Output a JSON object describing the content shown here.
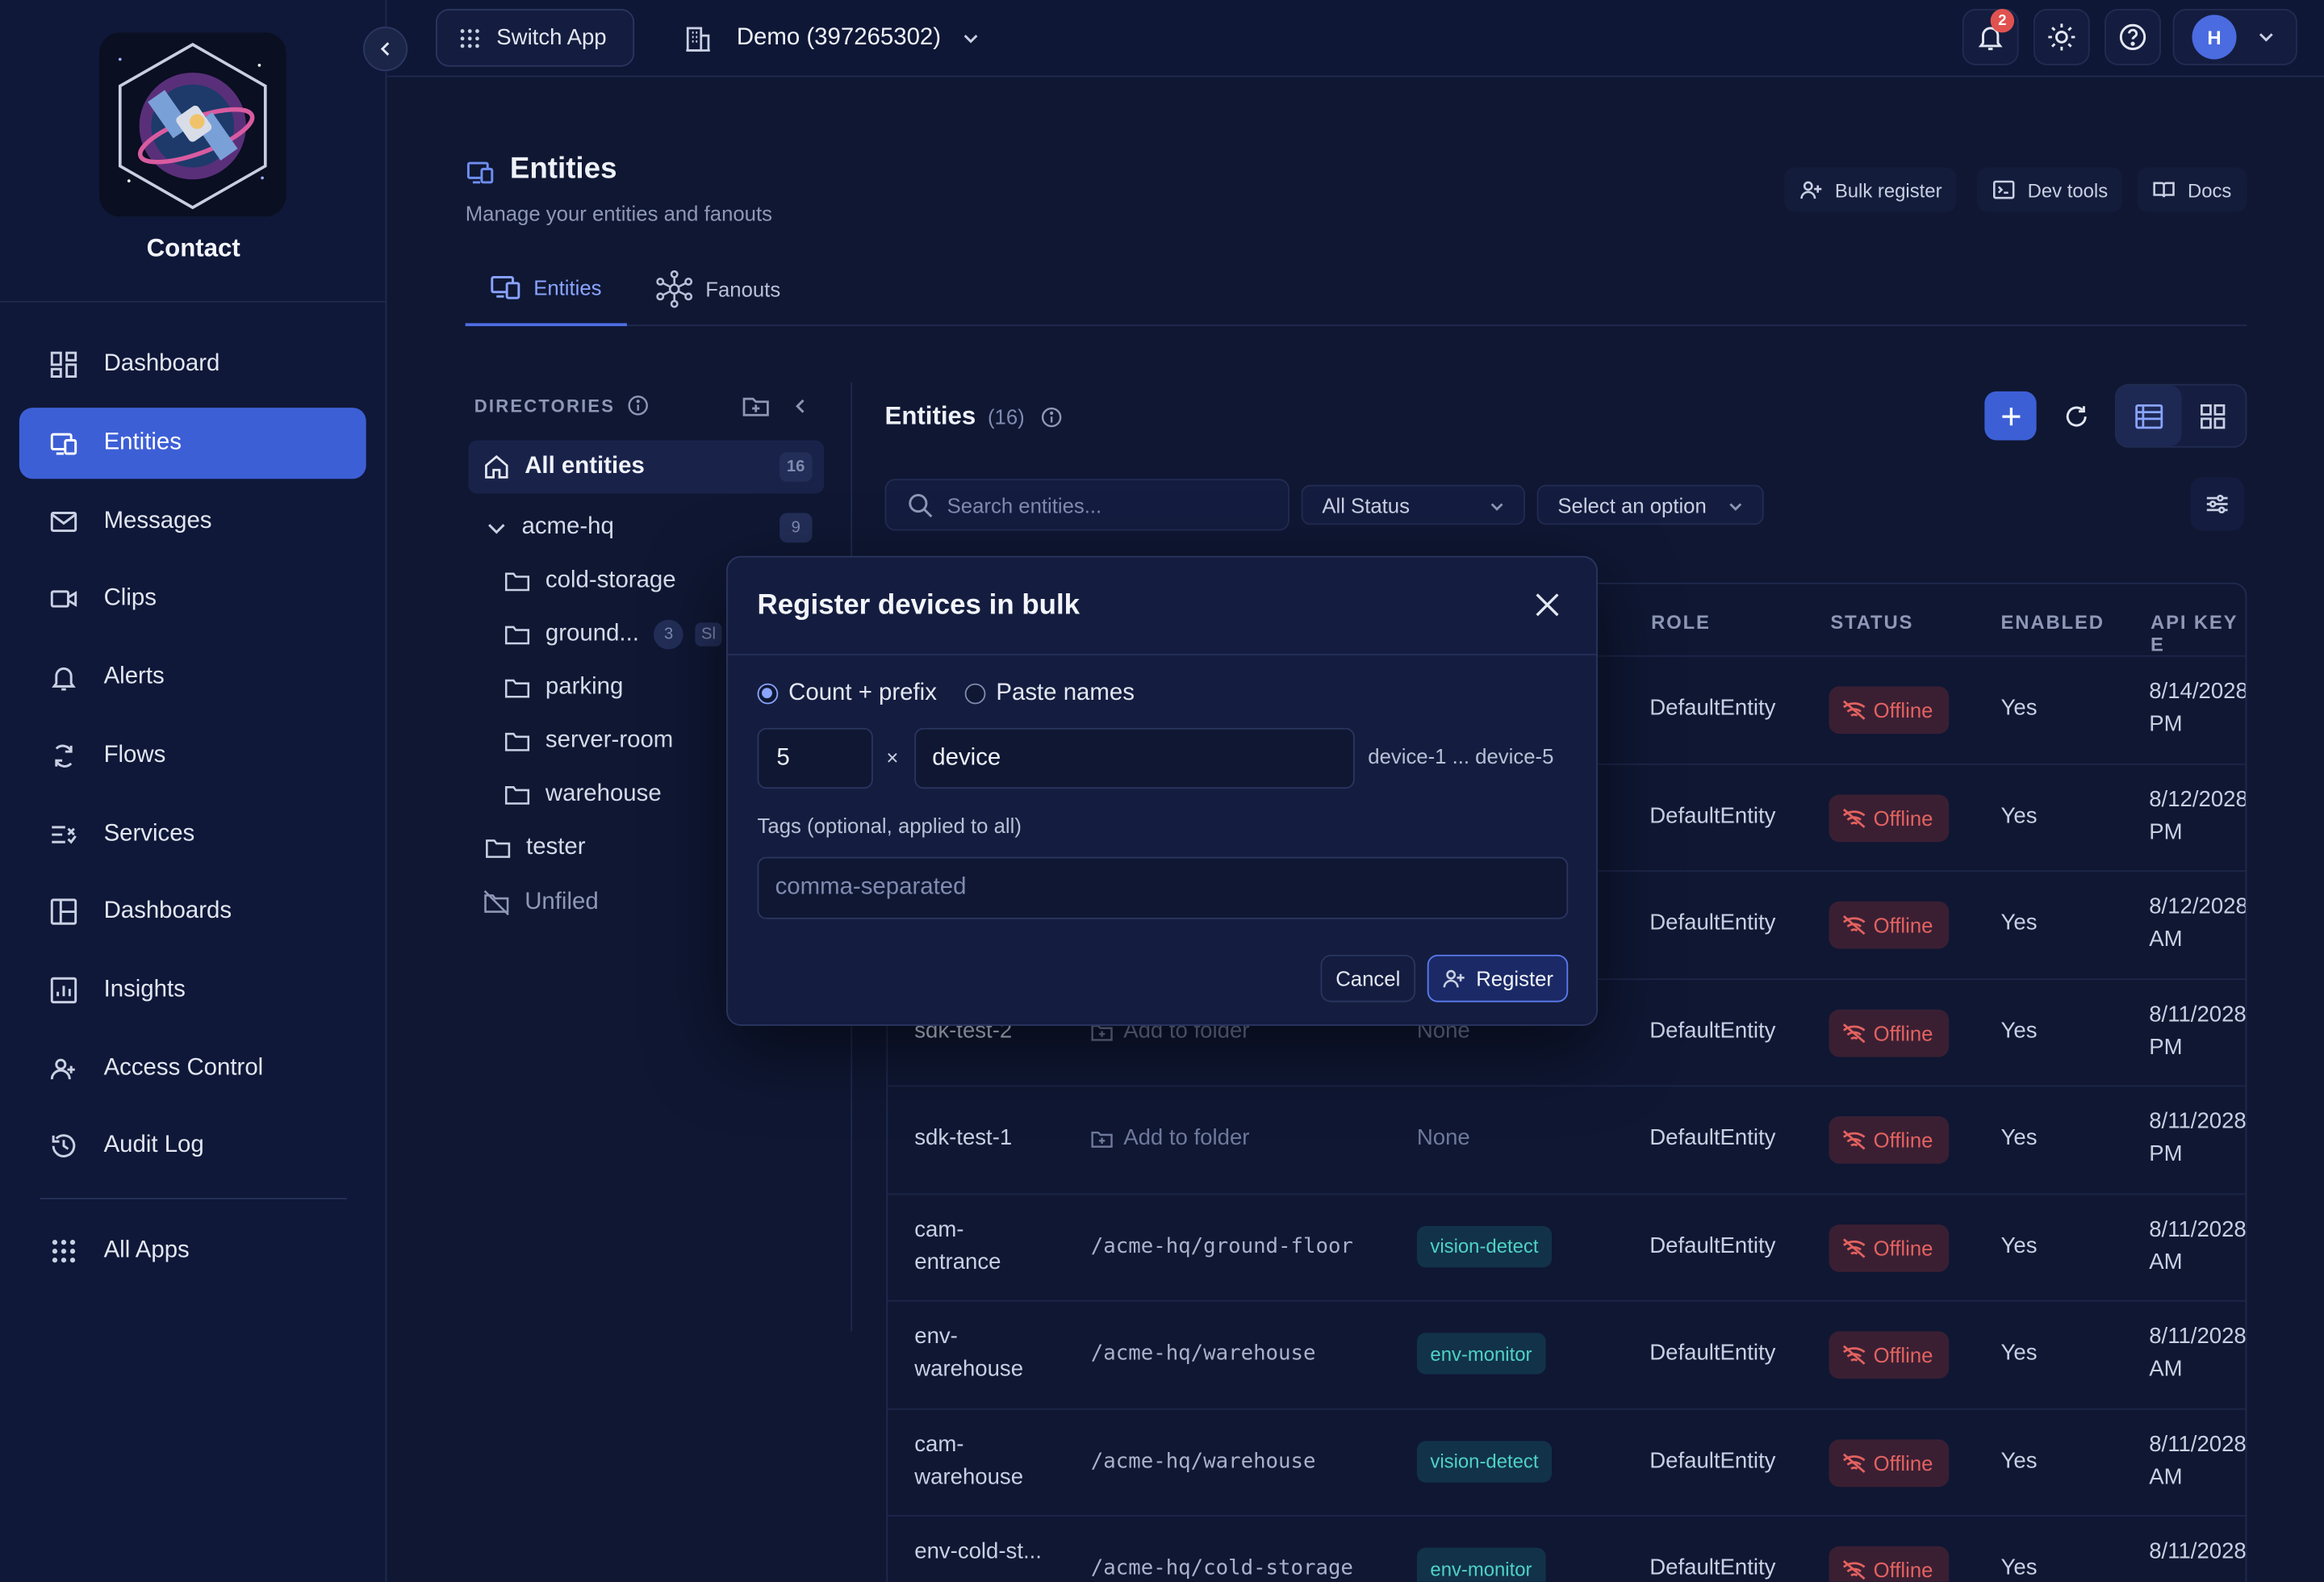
{
  "app": {
    "name": "Contact"
  },
  "topbar": {
    "switch_app": "Switch App",
    "tenant": "Demo (397265302)",
    "notification_count": "2",
    "user_initial": "H"
  },
  "sidebar": {
    "items": [
      {
        "label": "Dashboard",
        "icon": "dashboard-icon"
      },
      {
        "label": "Entities",
        "icon": "entities-icon"
      },
      {
        "label": "Messages",
        "icon": "mail-icon"
      },
      {
        "label": "Clips",
        "icon": "video-icon"
      },
      {
        "label": "Alerts",
        "icon": "bell-icon"
      },
      {
        "label": "Flows",
        "icon": "flow-icon"
      },
      {
        "label": "Services",
        "icon": "services-icon"
      },
      {
        "label": "Dashboards",
        "icon": "layout-icon"
      },
      {
        "label": "Insights",
        "icon": "chart-icon"
      },
      {
        "label": "Access Control",
        "icon": "users-icon"
      },
      {
        "label": "Audit Log",
        "icon": "history-icon"
      }
    ],
    "all_apps": "All Apps"
  },
  "page": {
    "title": "Entities",
    "subtitle": "Manage your entities and fanouts",
    "actions": {
      "bulk_register": "Bulk register",
      "dev_tools": "Dev tools",
      "docs": "Docs"
    },
    "tabs": [
      {
        "label": "Entities"
      },
      {
        "label": "Fanouts"
      }
    ]
  },
  "directories": {
    "header": "DIRECTORIES",
    "all": {
      "label": "All entities",
      "count": "16"
    },
    "root": {
      "label": "acme-hq",
      "count": "9"
    },
    "children": [
      {
        "label": "cold-storage"
      },
      {
        "label": "ground...",
        "count": "3",
        "extra": "Sl"
      },
      {
        "label": "parking"
      },
      {
        "label": "server-room"
      },
      {
        "label": "warehouse"
      }
    ],
    "tester": "tester",
    "unfiled": "Unfiled"
  },
  "entities": {
    "title": "Entities",
    "count": "(16)",
    "search_placeholder": "Search entities...",
    "status_filter": "All Status",
    "option_filter": "Select an option",
    "columns": {
      "role": "ROLE",
      "status": "STATUS",
      "enabled": "ENABLED",
      "api_key": "API KEY E"
    },
    "rows": [
      {
        "name": "",
        "folder": "",
        "tag": "",
        "role": "DefaultEntity",
        "status": "Offline",
        "enabled": "Yes",
        "date": "8/14/2028 PM"
      },
      {
        "name": "",
        "folder": "",
        "tag": "",
        "role": "DefaultEntity",
        "status": "Offline",
        "enabled": "Yes",
        "date": "8/12/2028 PM"
      },
      {
        "name": "",
        "folder": "",
        "tag": "",
        "role": "DefaultEntity",
        "status": "Offline",
        "enabled": "Yes",
        "date": "8/12/2028 AM"
      },
      {
        "name": "sdk-test-2",
        "folder": "Add to folder",
        "tag": "None",
        "role": "DefaultEntity",
        "status": "Offline",
        "enabled": "Yes",
        "date": "8/11/2028 PM"
      },
      {
        "name": "sdk-test-1",
        "folder": "Add to folder",
        "tag": "None",
        "role": "DefaultEntity",
        "status": "Offline",
        "enabled": "Yes",
        "date": "8/11/2028 PM"
      },
      {
        "name": "cam-entrance",
        "folder": "/acme-hq/ground-floor",
        "tag": "vision-detect",
        "role": "DefaultEntity",
        "status": "Offline",
        "enabled": "Yes",
        "date": "8/11/2028 AM"
      },
      {
        "name": "env-warehouse",
        "folder": "/acme-hq/warehouse",
        "tag": "env-monitor",
        "role": "DefaultEntity",
        "status": "Offline",
        "enabled": "Yes",
        "date": "8/11/2028 AM"
      },
      {
        "name": "cam-warehouse",
        "folder": "/acme-hq/warehouse",
        "tag": "vision-detect",
        "role": "DefaultEntity",
        "status": "Offline",
        "enabled": "Yes",
        "date": "8/11/2028 AM"
      },
      {
        "name": "env-cold-st...",
        "folder": "/acme-hq/cold-storage",
        "tag": "env-monitor",
        "role": "DefaultEntity",
        "status": "Offline",
        "enabled": "Yes",
        "date": "8/11/2028"
      }
    ]
  },
  "modal": {
    "title": "Register devices in bulk",
    "mode_count": "Count + prefix",
    "mode_paste": "Paste names",
    "count_value": "5",
    "times": "×",
    "prefix_value": "device",
    "preview": "device-1 ... device-5",
    "tags_label": "Tags (optional, applied to all)",
    "tags_placeholder": "comma-separated",
    "cancel": "Cancel",
    "register": "Register"
  },
  "colors": {
    "accent": "#3d5fd6",
    "offline": "#e3625f",
    "tag": "#4fd2c4"
  }
}
